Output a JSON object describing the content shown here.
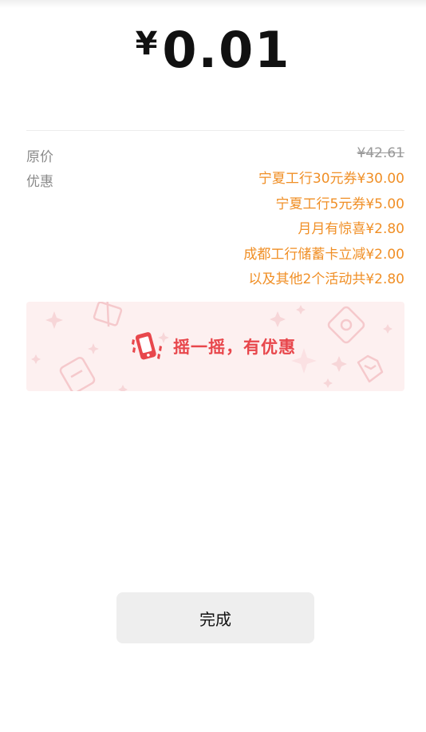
{
  "payment": {
    "currency_symbol": "¥",
    "amount": "0.01"
  },
  "details": {
    "original_price_label": "原价",
    "original_price": "¥42.61",
    "discount_label": "优惠",
    "discounts": [
      "宁夏工行30元券¥30.00",
      "宁夏工行5元券¥5.00",
      "月月有惊喜¥2.80",
      "成都工行储蓄卡立减¥2.00",
      "以及其他2个活动共¥2.80"
    ]
  },
  "banner": {
    "text": "摇一摇，有优惠",
    "icon": "shake-phone-icon",
    "accent_color": "#e8474c",
    "background_color": "#fdf0f0"
  },
  "actions": {
    "done_label": "完成"
  },
  "colors": {
    "discount_text": "#f08f26",
    "label_text": "#8a8a8a"
  }
}
